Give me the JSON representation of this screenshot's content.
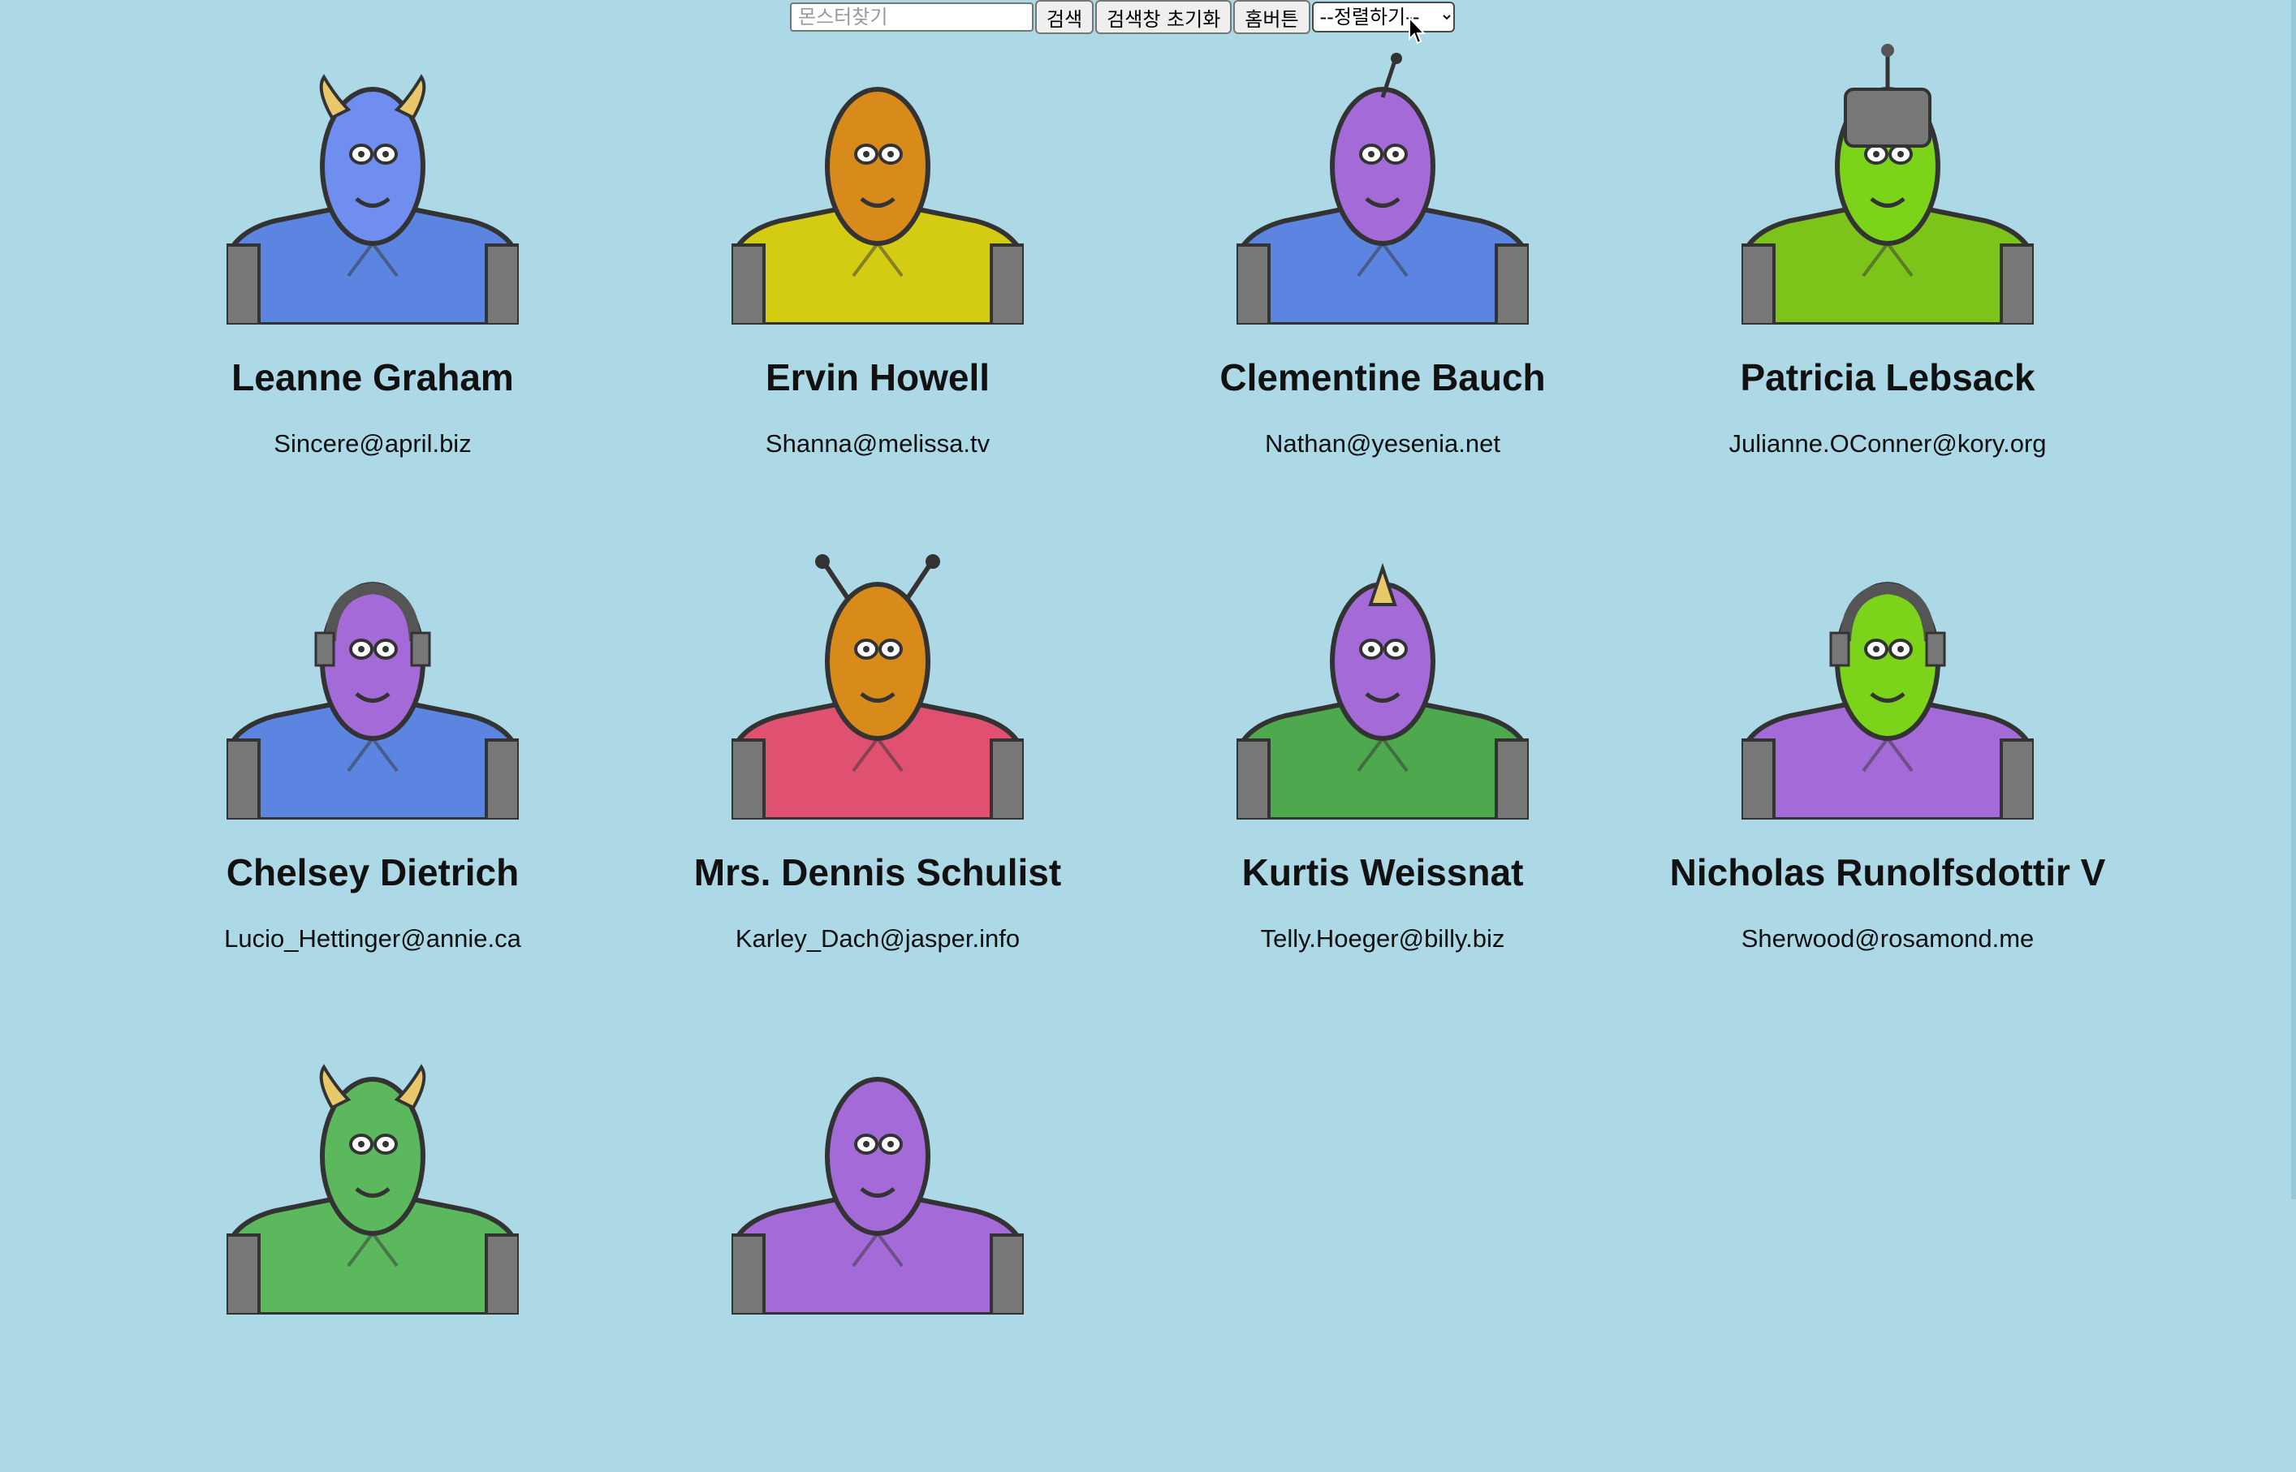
{
  "toolbar": {
    "search_placeholder": "몬스터찾기",
    "search_button": "검색",
    "reset_button": "검색창 초기화",
    "home_button": "홈버튼",
    "sort_selected": "--정렬하기--"
  },
  "monsters": [
    {
      "name": "Leanne Graham",
      "email": "Sincere@april.biz",
      "skin": "#6f8ef0",
      "body": "#5b85e0",
      "feature": "horns"
    },
    {
      "name": "Ervin Howell",
      "email": "Shanna@melissa.tv",
      "skin": "#d88a1a",
      "body": "#d4cc12",
      "feature": "spikes"
    },
    {
      "name": "Clementine Bauch",
      "email": "Nathan@yesenia.net",
      "skin": "#a46ad8",
      "body": "#5b85e0",
      "feature": "antenna"
    },
    {
      "name": "Patricia Lebsack",
      "email": "Julianne.OConner@kory.org",
      "skin": "#7cd41a",
      "body": "#7cc41a",
      "feature": "helmet"
    },
    {
      "name": "Chelsey Dietrich",
      "email": "Lucio_Hettinger@annie.ca",
      "skin": "#a46ad8",
      "body": "#5b85e0",
      "feature": "headset"
    },
    {
      "name": "Mrs. Dennis Schulist",
      "email": "Karley_Dach@jasper.info",
      "skin": "#d88a1a",
      "body": "#e05070",
      "feature": "antennae"
    },
    {
      "name": "Kurtis Weissnat",
      "email": "Telly.Hoeger@billy.biz",
      "skin": "#a46ad8",
      "body": "#4ea84e",
      "feature": "horn"
    },
    {
      "name": "Nicholas Runolfsdottir V",
      "email": "Sherwood@rosamond.me",
      "skin": "#7cd41a",
      "body": "#a46ad8",
      "feature": "headset"
    },
    {
      "name": "",
      "email": "",
      "skin": "#5cb85c",
      "body": "#5cb85c",
      "feature": "horns"
    },
    {
      "name": "",
      "email": "",
      "skin": "#a46ad8",
      "body": "#a46ad8",
      "feature": "none"
    }
  ]
}
